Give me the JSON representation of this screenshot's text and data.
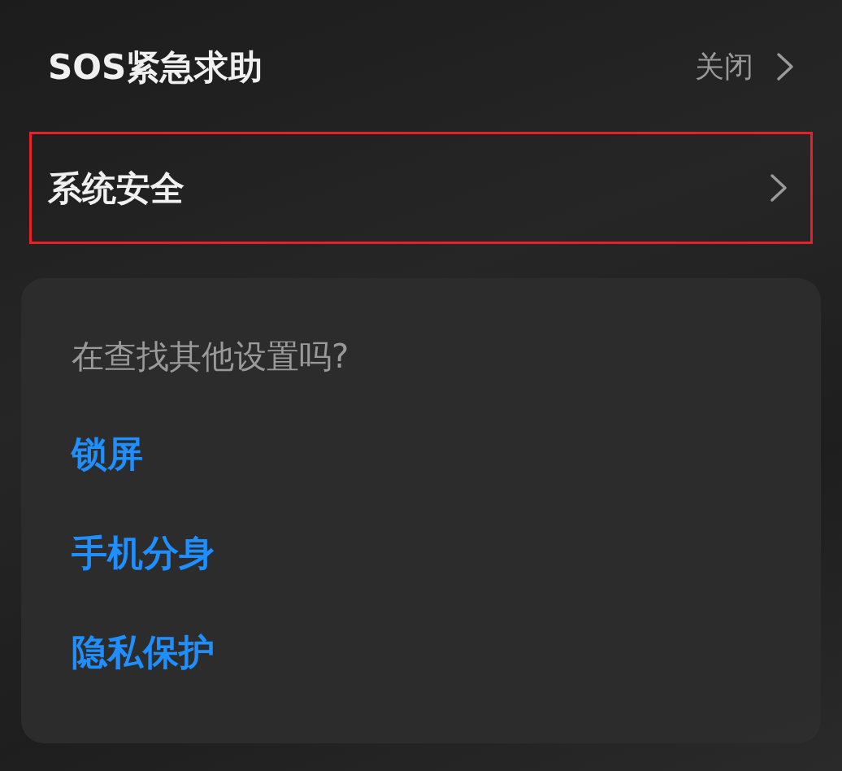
{
  "rows": [
    {
      "label": "SOS紧急求助",
      "value": "关闭",
      "highlighted": false
    },
    {
      "label": "系统安全",
      "highlighted": true
    }
  ],
  "suggestions": {
    "title": "在查找其他设置吗?",
    "links": [
      "锁屏",
      "手机分身",
      "隐私保护"
    ]
  }
}
